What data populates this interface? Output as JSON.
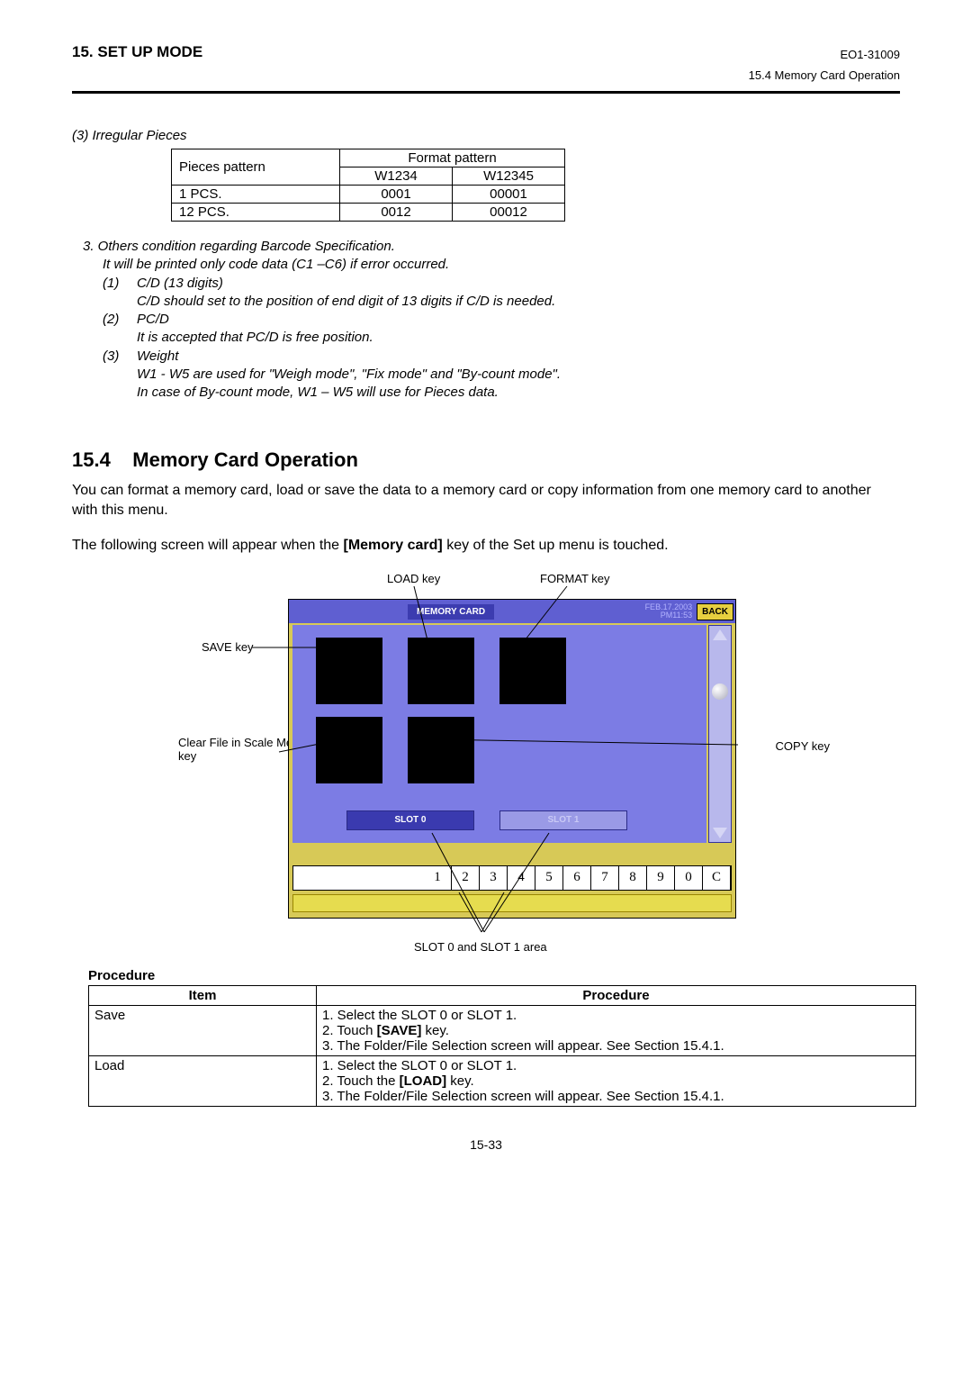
{
  "header": {
    "left": "15. SET UP MODE",
    "right_code": "EO1-31009",
    "right_sub": "15.4 Memory Card Operation"
  },
  "irregular": {
    "title": "(3) Irregular Pieces",
    "h_pieces": "Pieces pattern",
    "h_format": "Format pattern",
    "h_w1": "W1234",
    "h_w2": "W12345",
    "rows": [
      [
        "1 PCS.",
        "0001",
        "00001"
      ],
      [
        "12 PCS.",
        "0012",
        "00012"
      ]
    ]
  },
  "notes": {
    "l0": "3.  Others condition regarding Barcode Specification.",
    "l1": "It will be printed only code data (C1 –C6) if error occurred.",
    "i1": "(1)",
    "t1": "C/D (13 digits)",
    "s1": "C/D should set to the position of end digit of 13 digits if C/D is needed.",
    "i2": "(2)",
    "t2": "PC/D",
    "s2": "It is accepted that PC/D is free position.",
    "i3": "(3)",
    "t3": "Weight",
    "s3a": "W1 - W5 are used for \"Weigh mode\", \"Fix mode\" and \"By-count mode\".",
    "s3b": "In case of By-count mode, W1 – W5 will use for Pieces data."
  },
  "section": {
    "num": "15.4",
    "title": "Memory Card Operation",
    "p1": "You can format a memory card, load or save the data to a memory card or copy information from one memory card to another with this menu.",
    "p2a": "The following screen will appear when the ",
    "p2b": "[Memory card]",
    "p2c": " key of the Set up menu is touched."
  },
  "callouts": {
    "load": "LOAD key",
    "format": "FORMAT key",
    "save": "SAVE key",
    "clear": "Clear File in Scale Memory key",
    "copy": "COPY key",
    "slot": "SLOT 0 and SLOT 1 area"
  },
  "screen": {
    "title": "MEMORY CARD",
    "date": "FEB.17.2003",
    "time": "PM11:53",
    "back": "BACK",
    "slot0": "SLOT 0",
    "slot1": "SLOT 1",
    "keys": [
      "1",
      "2",
      "3",
      "4",
      "5",
      "6",
      "7",
      "8",
      "9",
      "0",
      "C"
    ]
  },
  "proc": {
    "heading": "Procedure",
    "h_item": "Item",
    "h_proc": "Procedure",
    "r1_item": "Save",
    "r1_1": "1. Select the SLOT 0 or SLOT 1.",
    "r1_2a": "2. Touch ",
    "r1_2b": "[SAVE]",
    "r1_2c": " key.",
    "r1_3": "3. The Folder/File Selection screen will appear.  See Section 15.4.1.",
    "r2_item": "Load",
    "r2_1": "1. Select the SLOT 0 or SLOT 1.",
    "r2_2a": "2. Touch the ",
    "r2_2b": "[LOAD]",
    "r2_2c": " key.",
    "r2_3": "3. The Folder/File Selection screen will appear.  See Section 15.4.1."
  },
  "footer": "15-33"
}
